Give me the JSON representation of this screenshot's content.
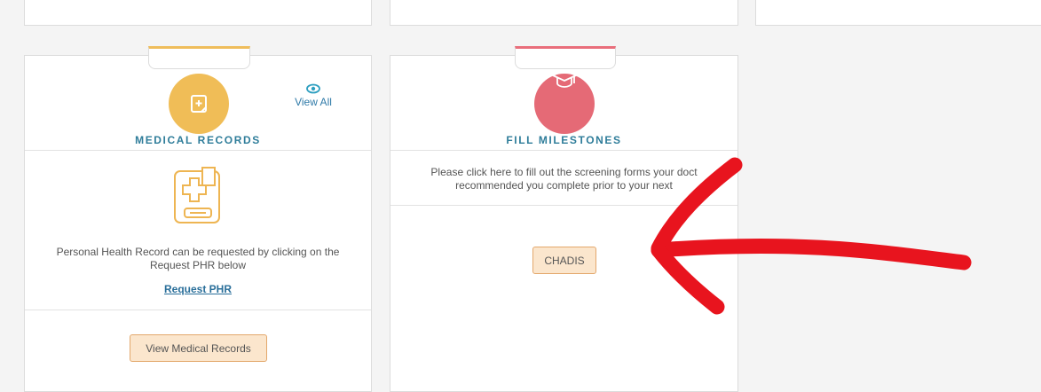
{
  "medical_records": {
    "title": "MEDICAL RECORDS",
    "view_all": "View All",
    "description": "Personal Health Record can be requested by clicking on the Request PHR below",
    "request_link": "Request PHR",
    "button": "View Medical Records",
    "accent": "#f0bd57"
  },
  "milestones": {
    "title": "FILL MILESTONES",
    "description_line1": "Please click here to fill out the screening forms your doct",
    "description_line2": "recommended you complete prior to your next",
    "button": "CHADIS",
    "accent": "#e56a76"
  },
  "annotation": {
    "arrow_color": "#e8141e"
  },
  "icons": [
    "document-plus-icon",
    "eye-icon",
    "medical-record-icon",
    "graduation-cap-icon",
    "red-arrow-annotation"
  ]
}
